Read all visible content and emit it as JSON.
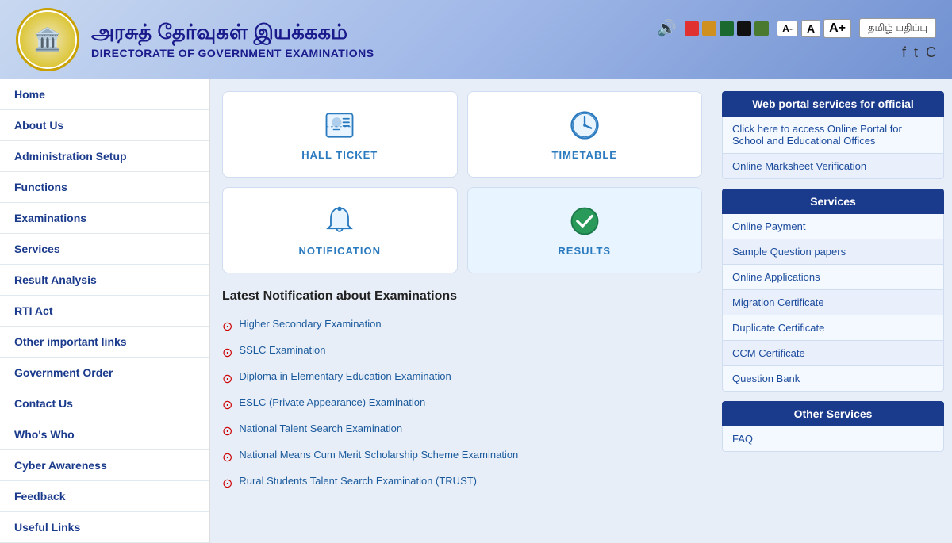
{
  "header": {
    "title_tamil": "அரசுத் தேர்வுகள் இயக்ககம்",
    "title_english": "DIRECTORATE OF GOVERNMENT EXAMINATIONS",
    "font_buttons": [
      "A-",
      "A",
      "A+"
    ],
    "tamil_btn": "தமிழ் பதிப்பு",
    "swatches": [
      {
        "color": "#e03030"
      },
      {
        "color": "#d09020"
      },
      {
        "color": "#1a6a30"
      },
      {
        "color": "#111111"
      },
      {
        "color": "#4a7a30"
      }
    ]
  },
  "sidebar": {
    "items": [
      {
        "label": "Home"
      },
      {
        "label": "About Us"
      },
      {
        "label": "Administration Setup"
      },
      {
        "label": "Functions"
      },
      {
        "label": "Examinations"
      },
      {
        "label": "Services"
      },
      {
        "label": "Result Analysis"
      },
      {
        "label": "RTI Act"
      },
      {
        "label": "Other important links"
      },
      {
        "label": "Government Order"
      },
      {
        "label": "Contact Us"
      },
      {
        "label": "Who's Who"
      },
      {
        "label": "Cyber Awareness"
      },
      {
        "label": "Feedback"
      },
      {
        "label": "Useful Links"
      }
    ]
  },
  "quick_links": [
    {
      "label": "HALL TICKET",
      "icon": "hall-ticket"
    },
    {
      "label": "TIMETABLE",
      "icon": "timetable"
    },
    {
      "label": "NOTIFICATION",
      "icon": "notification"
    },
    {
      "label": "RESULTS",
      "icon": "results"
    }
  ],
  "notifications": {
    "heading": "Latest Notification about Examinations",
    "items": [
      "Higher Secondary Examination",
      "SSLC Examination",
      "Diploma in Elementary Education Examination",
      "ESLC (Private Appearance) Examination",
      "National Talent Search Examination",
      "National Means Cum Merit Scholarship Scheme Examination",
      "Rural Students Talent Search Examination (TRUST)"
    ]
  },
  "right_sidebar": {
    "portal_section": {
      "header": "Web portal services for official",
      "items": [
        "Click here to access Online Portal for School and Educational Offices",
        "Online Marksheet Verification"
      ]
    },
    "services_section": {
      "header": "Services",
      "items": [
        "Online Payment",
        "Sample Question papers",
        "Online Applications",
        "Migration Certificate",
        "Duplicate Certificate",
        "CCM Certificate",
        "Question Bank"
      ]
    },
    "other_services_section": {
      "header": "Other Services",
      "items": [
        "FAQ"
      ]
    }
  }
}
